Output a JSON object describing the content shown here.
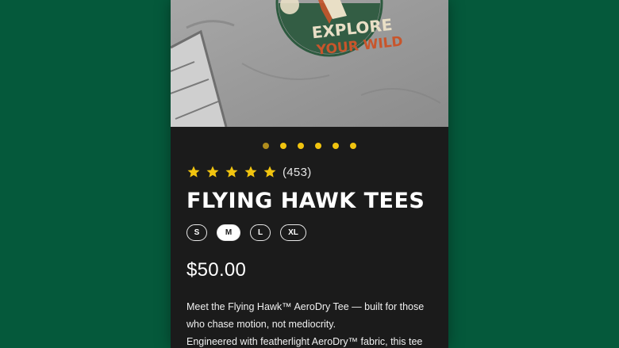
{
  "product": {
    "title": "FLYING HAWK TEES",
    "rating": 5,
    "review_count": "(453)",
    "price": "$50.00",
    "description_line1": "Meet the Flying Hawk™ AeroDry Tee — built for those who chase motion, not mediocrity.",
    "description_line2": " Engineered with featherlight AeroDry™ fabric, this tee"
  },
  "hero": {
    "badge_line1": "EXPLORE",
    "badge_line2": "YOUR WILD",
    "badge_text_color": "#e9dfc6",
    "badge_accent_color": "#c8552b",
    "badge_ring_color": "#2d5a3f"
  },
  "carousel": {
    "slide_count": 6,
    "active_index": 0
  },
  "sizes": [
    {
      "label": "S",
      "selected": false
    },
    {
      "label": "M",
      "selected": true
    },
    {
      "label": "L",
      "selected": false
    },
    {
      "label": "XL",
      "selected": false
    }
  ],
  "colors": {
    "page_background": "#05593b",
    "card_background": "#1b1b1b",
    "star": "#f1c40f",
    "dot_active": "#b08d1d"
  }
}
